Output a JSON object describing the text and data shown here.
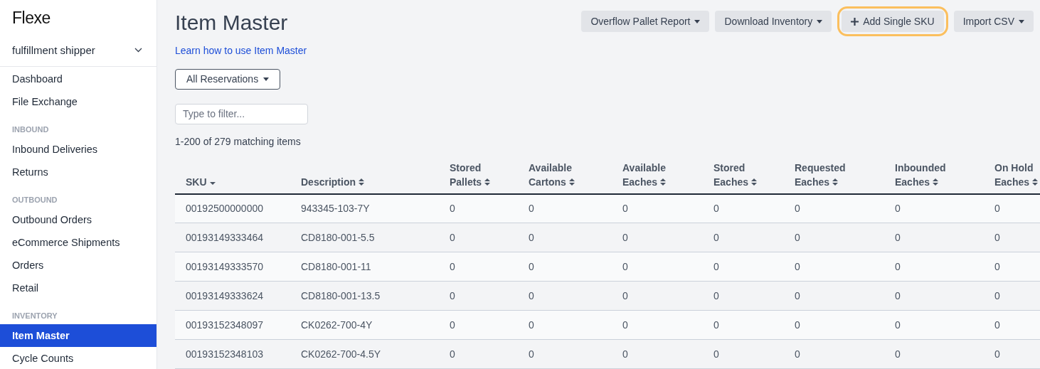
{
  "sidebar": {
    "logo": "Flexe",
    "account": "fulfillment shipper",
    "sections": [
      {
        "items": [
          {
            "label": "Dashboard",
            "selected": false
          },
          {
            "label": "File Exchange",
            "selected": false
          }
        ]
      },
      {
        "title": "INBOUND",
        "items": [
          {
            "label": "Inbound Deliveries",
            "selected": false
          },
          {
            "label": "Returns",
            "selected": false
          }
        ]
      },
      {
        "title": "OUTBOUND",
        "items": [
          {
            "label": "Outbound Orders",
            "selected": false
          },
          {
            "label": "eCommerce Shipments",
            "selected": false
          },
          {
            "label": "Orders",
            "selected": false
          },
          {
            "label": "Retail",
            "selected": false
          }
        ]
      },
      {
        "title": "INVENTORY",
        "items": [
          {
            "label": "Item Master",
            "selected": true
          },
          {
            "label": "Cycle Counts",
            "selected": false
          }
        ]
      }
    ]
  },
  "page": {
    "title": "Item Master",
    "help_link": "Learn how to use Item Master",
    "actions": [
      {
        "label": "Overflow Pallet Report",
        "kind": "dropdown",
        "focused": false
      },
      {
        "label": "Download Inventory",
        "kind": "dropdown",
        "focused": false
      },
      {
        "label": "Add Single SKU",
        "kind": "add",
        "focused": true
      },
      {
        "label": "Import CSV",
        "kind": "dropdown",
        "focused": false
      }
    ],
    "reservation_filter": "All Reservations",
    "filter": {
      "placeholder": "Type to filter..."
    },
    "match_count": "1-200 of 279 matching items"
  },
  "table": {
    "columns": [
      {
        "label": "SKU",
        "sorted": true
      },
      {
        "label": "Description",
        "sorted": false
      },
      {
        "label": "Stored Pallets",
        "sorted": false
      },
      {
        "label": "Available Cartons",
        "sorted": false
      },
      {
        "label": "Available Eaches",
        "sorted": false
      },
      {
        "label": "Stored Eaches",
        "sorted": false
      },
      {
        "label": "Requested Eaches",
        "sorted": false
      },
      {
        "label": "Inbounded Eaches",
        "sorted": false
      },
      {
        "label": "On Hold Eaches",
        "sorted": false
      }
    ],
    "rows": [
      [
        "00192500000000",
        "943345-103-7Y",
        "0",
        "0",
        "0",
        "0",
        "0",
        "0",
        "0"
      ],
      [
        "00193149333464",
        "CD8180-001-5.5",
        "0",
        "0",
        "0",
        "0",
        "0",
        "0",
        "0"
      ],
      [
        "00193149333570",
        "CD8180-001-11",
        "0",
        "0",
        "0",
        "0",
        "0",
        "0",
        "0"
      ],
      [
        "00193149333624",
        "CD8180-001-13.5",
        "0",
        "0",
        "0",
        "0",
        "0",
        "0",
        "0"
      ],
      [
        "00193152348097",
        "CK0262-700-4Y",
        "0",
        "0",
        "0",
        "0",
        "0",
        "0",
        "0"
      ],
      [
        "00193152348103",
        "CK0262-700-4.5Y",
        "0",
        "0",
        "0",
        "0",
        "0",
        "0",
        "0"
      ]
    ]
  }
}
